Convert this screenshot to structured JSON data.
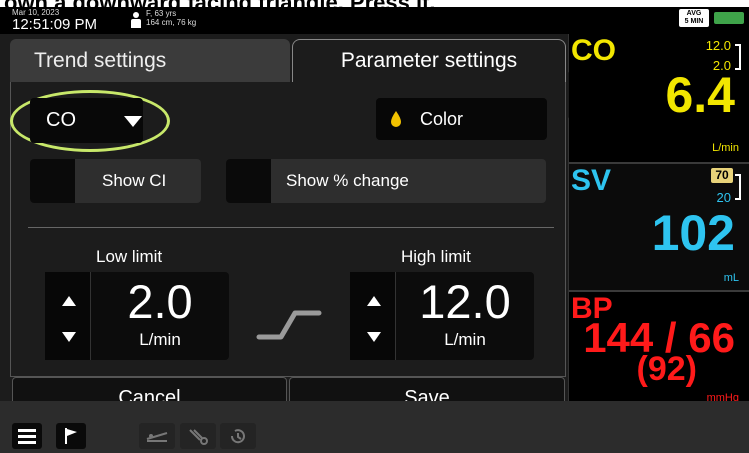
{
  "instruction_text": "own a downward facing triangle. Press it.",
  "status": {
    "date": "Mar 10, 2023",
    "time": "12:51:09 PM",
    "patient_line1": "F, 63 yrs",
    "patient_line2": "164 cm, 76 kg",
    "avg_label": "AVG",
    "avg_interval": "5 MIN"
  },
  "tabs": {
    "trend": "Trend settings",
    "parameter": "Parameter settings"
  },
  "parameter_select": {
    "value": "CO"
  },
  "color_button": {
    "label": "Color",
    "drop_color": "#f2c200"
  },
  "checkboxes": {
    "show_ci": "Show CI",
    "show_pct": "Show % change"
  },
  "limits": {
    "low_title": "Low limit",
    "low_value": "2.0",
    "low_unit": "L/min",
    "high_title": "High limit",
    "high_value": "12.0",
    "high_unit": "L/min"
  },
  "footer": {
    "cancel": "Cancel",
    "save": "Save"
  },
  "tiles": {
    "co": {
      "label": "CO",
      "hi": "12.0",
      "lo": "2.0",
      "value": "6.4",
      "unit": "L/min",
      "color": "#f2e600"
    },
    "sv": {
      "label": "SV",
      "hi": "70",
      "lo": "20",
      "value": "102",
      "unit": "mL",
      "color": "#2ec4f0"
    },
    "bp": {
      "label": "BP",
      "value": "144 / 66",
      "map": "(92)",
      "unit": "mmHg",
      "color": "#ff1a1a"
    }
  }
}
